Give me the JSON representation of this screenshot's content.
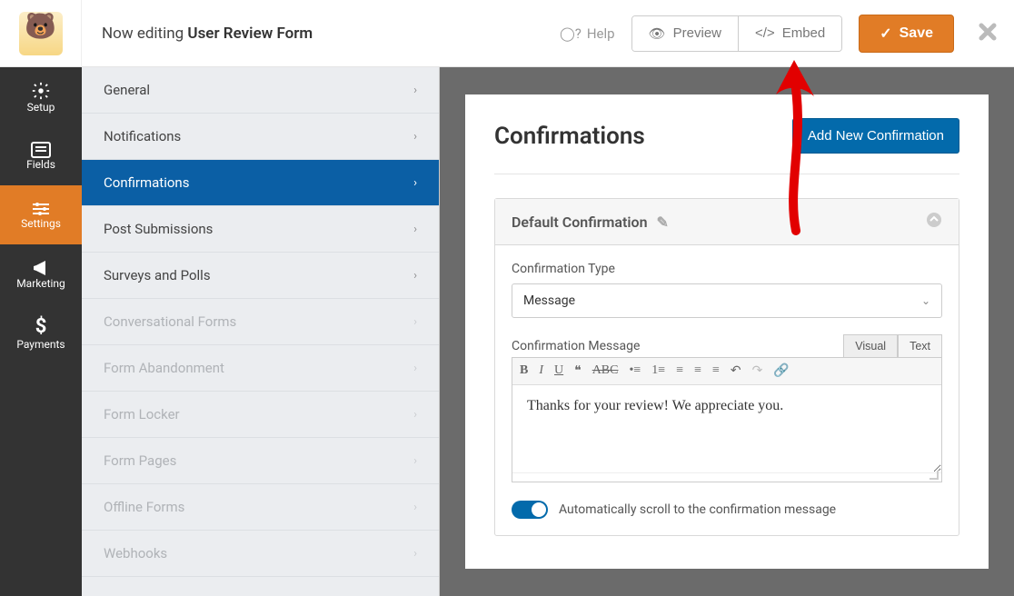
{
  "topbar": {
    "editing_prefix": "Now editing",
    "form_name": "User Review Form",
    "help": "Help",
    "preview": "Preview",
    "embed": "Embed",
    "save": "Save"
  },
  "rail": {
    "items": [
      {
        "label": "Setup",
        "icon": "⚙"
      },
      {
        "label": "Fields",
        "icon": "☰"
      },
      {
        "label": "Settings",
        "icon": "⚙"
      },
      {
        "label": "Marketing",
        "icon": "📣"
      },
      {
        "label": "Payments",
        "icon": "$"
      }
    ],
    "active_index": 2
  },
  "settings_sidebar": {
    "items": [
      {
        "label": "General",
        "disabled": false
      },
      {
        "label": "Notifications",
        "disabled": false
      },
      {
        "label": "Confirmations",
        "disabled": false
      },
      {
        "label": "Post Submissions",
        "disabled": false
      },
      {
        "label": "Surveys and Polls",
        "disabled": false
      },
      {
        "label": "Conversational Forms",
        "disabled": true
      },
      {
        "label": "Form Abandonment",
        "disabled": true
      },
      {
        "label": "Form Locker",
        "disabled": true
      },
      {
        "label": "Form Pages",
        "disabled": true
      },
      {
        "label": "Offline Forms",
        "disabled": true
      },
      {
        "label": "Webhooks",
        "disabled": true
      }
    ],
    "active_index": 2
  },
  "content": {
    "heading": "Confirmations",
    "add_button": "Add New Confirmation",
    "panel": {
      "title": "Default Confirmation",
      "type_label": "Confirmation Type",
      "type_value": "Message",
      "message_label": "Confirmation Message",
      "editor_tabs": {
        "visual": "Visual",
        "text": "Text",
        "active": "visual"
      },
      "message_body": "Thanks for your review! We appreciate you.",
      "toggle_label": "Automatically scroll to the confirmation message",
      "toggle_on": true
    }
  }
}
